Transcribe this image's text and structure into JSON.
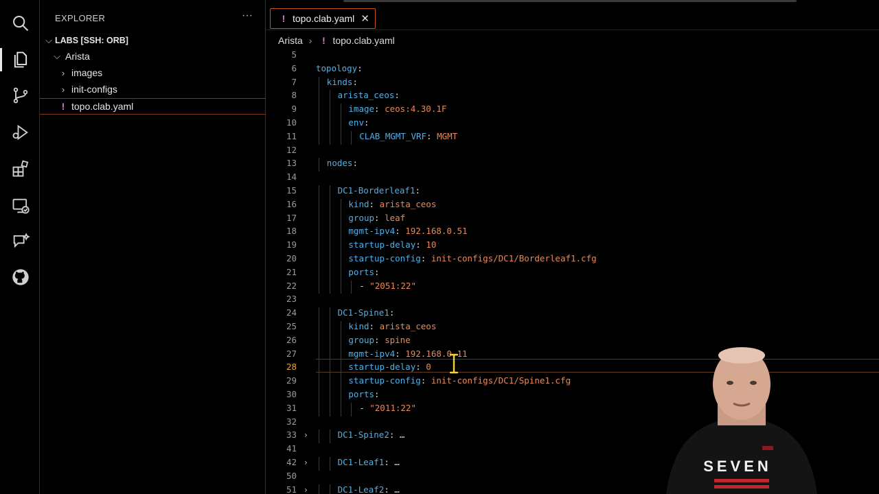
{
  "explorer": {
    "title": "EXPLORER",
    "more": "···",
    "workspace": "LABS [SSH: ORB]",
    "folder": "Arista",
    "items": [
      "images",
      "init-configs"
    ],
    "file": "topo.clab.yaml",
    "bang": "!"
  },
  "tab": {
    "label": "topo.clab.yaml",
    "close": "✕"
  },
  "breadcrumb": {
    "folder": "Arista",
    "sep": "›",
    "file": "topo.clab.yaml"
  },
  "editor": {
    "current_line": "28",
    "lines": [
      {
        "n": "5",
        "text": ""
      },
      {
        "n": "6",
        "key": "topology",
        "rest": ":",
        "indent": 0
      },
      {
        "n": "7",
        "key": "kinds",
        "rest": ":",
        "indent": 1
      },
      {
        "n": "8",
        "key": "arista_ceos",
        "rest": ":",
        "indent": 2
      },
      {
        "n": "9",
        "key": "image",
        "rest": ": ",
        "val": "ceos:4.30.1F",
        "indent": 3
      },
      {
        "n": "10",
        "key": "env",
        "rest": ":",
        "indent": 3
      },
      {
        "n": "11",
        "key": "CLAB_MGMT_VRF",
        "rest": ": ",
        "val": "MGMT",
        "indent": 4
      },
      {
        "n": "12",
        "text": ""
      },
      {
        "n": "13",
        "key": "nodes",
        "rest": ":",
        "indent": 1
      },
      {
        "n": "14",
        "text": ""
      },
      {
        "n": "15",
        "key": "DC1-Borderleaf1",
        "rest": ":",
        "indent": 2
      },
      {
        "n": "16",
        "key": "kind",
        "rest": ": ",
        "val": "arista_ceos",
        "indent": 3
      },
      {
        "n": "17",
        "key": "group",
        "rest": ": ",
        "val": "leaf",
        "indent": 3
      },
      {
        "n": "18",
        "key": "mgmt-ipv4",
        "rest": ": ",
        "val": "192.168.0.51",
        "indent": 3
      },
      {
        "n": "19",
        "key": "startup-delay",
        "rest": ": ",
        "val": "10",
        "indent": 3
      },
      {
        "n": "20",
        "key": "startup-config",
        "rest": ": ",
        "val": "init-configs/DC1/Borderleaf1.cfg",
        "indent": 3
      },
      {
        "n": "21",
        "key": "ports",
        "rest": ":",
        "indent": 3
      },
      {
        "n": "22",
        "dash": "- ",
        "val": "\"2051:22\"",
        "indent": 4
      },
      {
        "n": "23",
        "text": ""
      },
      {
        "n": "24",
        "key": "DC1-Spine1",
        "rest": ":",
        "indent": 2
      },
      {
        "n": "25",
        "key": "kind",
        "rest": ": ",
        "val": "arista_ceos",
        "indent": 3
      },
      {
        "n": "26",
        "key": "group",
        "rest": ": ",
        "val": "spine",
        "indent": 3
      },
      {
        "n": "27",
        "key": "mgmt-ipv4",
        "rest": ": ",
        "val": "192.168.0.11",
        "indent": 3
      },
      {
        "n": "28",
        "key": "startup-delay",
        "rest": ": ",
        "val": "0",
        "indent": 3
      },
      {
        "n": "29",
        "key": "startup-config",
        "rest": ": ",
        "val": "init-configs/DC1/Spine1.cfg",
        "indent": 3
      },
      {
        "n": "30",
        "key": "ports",
        "rest": ":",
        "indent": 3
      },
      {
        "n": "31",
        "dash": "- ",
        "val": "\"2011:22\"",
        "indent": 4
      },
      {
        "n": "32",
        "text": ""
      },
      {
        "n": "33",
        "key": "DC1-Spine2",
        "rest": ":",
        "fold": true,
        "ellipsis": "…",
        "indent": 2
      },
      {
        "n": "41",
        "text": ""
      },
      {
        "n": "42",
        "key": "DC1-Leaf1",
        "rest": ":",
        "fold": true,
        "ellipsis": "…",
        "indent": 2
      },
      {
        "n": "50",
        "text": ""
      },
      {
        "n": "51",
        "key": "DC1-Leaf2",
        "rest": ":",
        "fold": true,
        "ellipsis": "…",
        "indent": 2
      }
    ]
  },
  "webcam": {
    "shirt_text": "SEVEN"
  },
  "colors": {
    "accent_tab": "#c8541a",
    "yaml_key": "#4fb0e8",
    "yaml_value": "#e8895a",
    "yaml_bang": "#c586c0"
  }
}
